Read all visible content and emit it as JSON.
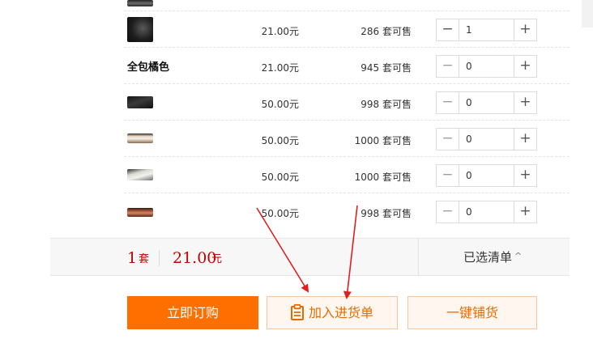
{
  "rows": [
    {
      "name": "",
      "price": "",
      "stock": "",
      "qty": ""
    },
    {
      "name": "",
      "price": "21.00元",
      "stock": "286 套可售",
      "qty": "1"
    },
    {
      "name": "全包橘色",
      "price": "21.00元",
      "stock": "945 套可售",
      "qty": "0"
    },
    {
      "name": "",
      "price": "50.00元",
      "stock": "998 套可售",
      "qty": "0"
    },
    {
      "name": "",
      "price": "50.00元",
      "stock": "1000 套可售",
      "qty": "0"
    },
    {
      "name": "",
      "price": "50.00元",
      "stock": "1000 套可售",
      "qty": "0"
    },
    {
      "name": "",
      "price": "50.00元",
      "stock": "998 套可售",
      "qty": "0"
    }
  ],
  "stepper": {
    "minus": "−",
    "plus": "+"
  },
  "summary": {
    "count": "1",
    "count_unit": "套",
    "total": "21.00",
    "currency": "元",
    "selected_list": "已选清单",
    "caret": "^"
  },
  "buttons": {
    "buy_now": "立即订购",
    "add_to_cart": "加入进货单",
    "one_click_stock": "一键铺货"
  },
  "colors": {
    "accent": "#ff6f00",
    "price_red": "#c40000",
    "arrow_red": "#e0201f"
  },
  "icons": {
    "cart": "clipboard-icon",
    "caret": "caret-up-icon"
  }
}
